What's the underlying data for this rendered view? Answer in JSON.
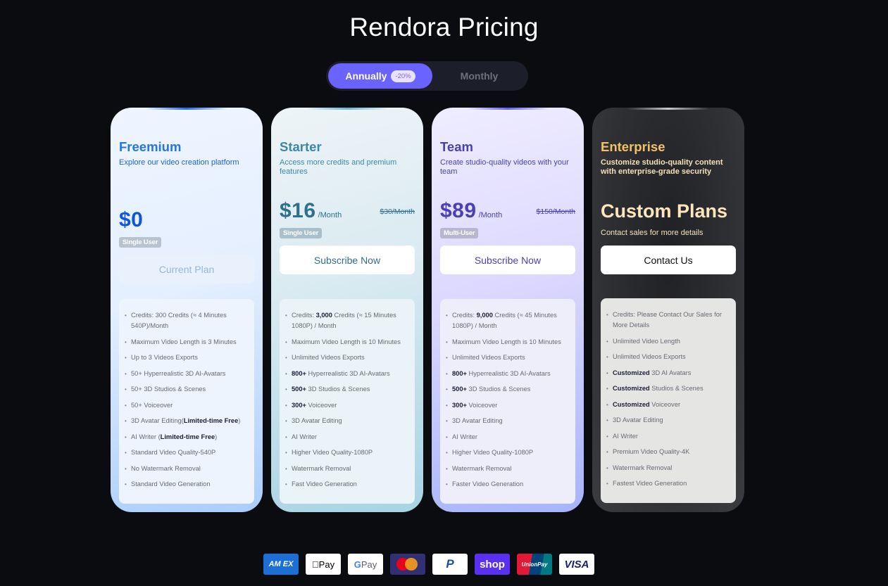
{
  "header": {
    "title": "Rendora Pricing"
  },
  "billing_toggle": {
    "options": [
      {
        "label": "Annually",
        "badge": "-20%",
        "selected": true
      },
      {
        "label": "Monthly",
        "selected": false
      }
    ]
  },
  "plans": [
    {
      "name": "Freemium",
      "description": "Explore our video creation platform",
      "price": "$0",
      "user_type": "Single User",
      "cta": "Current Plan",
      "features": [
        {
          "text": "Credits:  300 Credits (≈ 4 Minutes 540P)/Month"
        },
        {
          "text": "Maximum Video Length is 3 Minutes"
        },
        {
          "text": "Up to 3 Videos Exports"
        },
        {
          "text": "50+ Hyperrealistic 3D AI-Avatars"
        },
        {
          "text": "50+ 3D Studios & Scenes"
        },
        {
          "text": "50+ Voiceover"
        },
        {
          "pre": "3D Avatar Editing(",
          "bold": "Limited-time Free",
          "post": ")"
        },
        {
          "pre": "AI Writer (",
          "bold": "Limited-time Free",
          "post": ")"
        },
        {
          "text": "Standard Video Quality-540P"
        },
        {
          "text": "No Watermark Removal"
        },
        {
          "text": "Standard Video Generation"
        }
      ]
    },
    {
      "name": "Starter",
      "description": "Access more credits and premium features",
      "price": "$16",
      "per": "/Month",
      "original_price": "$30/Month",
      "user_type": "Single User",
      "cta": "Subscribe Now",
      "features": [
        {
          "pre": "Credits:  ",
          "bold": "3,000",
          "post": " Credits (≈ 15 Minutes 1080P) / Month"
        },
        {
          "text": "Maximum Video Length is 10 Minutes"
        },
        {
          "text": "Unlimited Videos Exports"
        },
        {
          "bold": "800+",
          "post": " Hyperrealistic 3D AI-Avatars"
        },
        {
          "bold": "500+",
          "post": " 3D Studios & Scenes"
        },
        {
          "bold": "300+",
          "post": " Voiceover"
        },
        {
          "text": "3D Avatar Editing"
        },
        {
          "text": "AI Writer"
        },
        {
          "text": "Higher Video Quality-1080P"
        },
        {
          "text": "Watermark Removal"
        },
        {
          "text": "Fast Video Generation"
        }
      ]
    },
    {
      "name": "Team",
      "description": "Create studio-quality videos with your team",
      "price": "$89",
      "per": "/Month",
      "original_price": "$150/Month",
      "user_type": "Multi-User",
      "cta": "Subscribe Now",
      "features": [
        {
          "pre": "Credits:  ",
          "bold": "9,000",
          "post": " Credits (≈ 45 Minutes 1080P) / Month"
        },
        {
          "text": "Maximum Video Length is 10 Minutes"
        },
        {
          "text": "Unlimited Videos Exports"
        },
        {
          "bold": "800+",
          "post": " Hyperrealistic 3D AI-Avatars"
        },
        {
          "bold": "500+",
          "post": " 3D Studios & Scenes"
        },
        {
          "bold": "300+",
          "post": " Voiceover"
        },
        {
          "text": "3D Avatar Editing"
        },
        {
          "text": "AI Writer"
        },
        {
          "text": "Higher Video Quality-1080P"
        },
        {
          "text": "Watermark Removal"
        },
        {
          "text": "Faster Video Generation"
        }
      ]
    },
    {
      "name": "Enterprise",
      "description": "Customize studio-quality content with enterprise-grade security",
      "price": "Custom Plans",
      "contact_note": "Contact sales for more details",
      "cta": "Contact Us",
      "features": [
        {
          "text": "Credits:  Please Contact Our Sales for More Details"
        },
        {
          "text": "Unlimited Video Length"
        },
        {
          "text": "Unlimited Videos Exports"
        },
        {
          "bold": "Customized",
          "post": " 3D AI Avatars"
        },
        {
          "bold": "Customized",
          "post": " Studios & Scenes"
        },
        {
          "bold": "Customized",
          "post": " Voiceover"
        },
        {
          "text": "3D Avatar Editing"
        },
        {
          "text": "AI Writer"
        },
        {
          "text": "Premium Video Quality-4K"
        },
        {
          "text": "Watermark Removal"
        },
        {
          "text": "Fastest Video Generation"
        }
      ]
    }
  ],
  "payment_methods": [
    {
      "icon": "amex-icon",
      "label": "AM EX"
    },
    {
      "icon": "apple-pay-icon",
      "label": " Pay"
    },
    {
      "icon": "google-pay-icon",
      "g": "G",
      "label": "Pay"
    },
    {
      "icon": "mastercard-icon",
      "label": ""
    },
    {
      "icon": "paypal-icon",
      "label": "P"
    },
    {
      "icon": "shop-pay-icon",
      "label": "shop"
    },
    {
      "icon": "unionpay-icon",
      "label": "UnionPay"
    },
    {
      "icon": "visa-icon",
      "label": "VISA"
    }
  ]
}
